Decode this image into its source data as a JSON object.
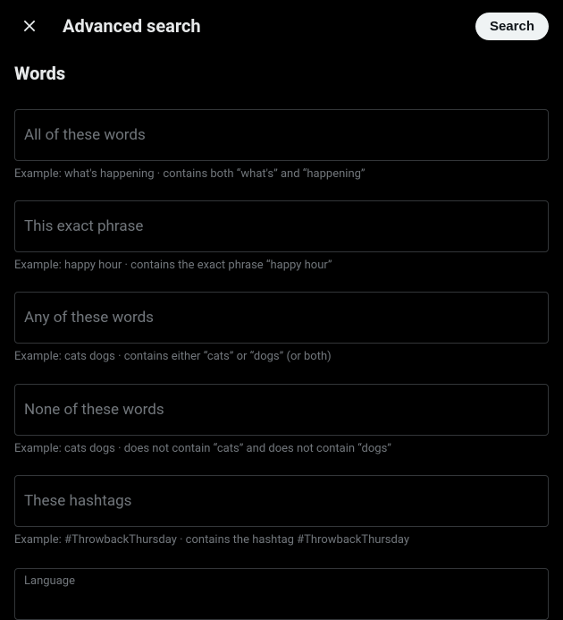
{
  "header": {
    "title": "Advanced search",
    "search_label": "Search"
  },
  "section": {
    "words_title": "Words"
  },
  "fields": {
    "all_words": {
      "label": "All of these words",
      "example": "Example: what's happening · contains both “what's” and “happening”"
    },
    "exact_phrase": {
      "label": "This exact phrase",
      "example": "Example: happy hour · contains the exact phrase “happy hour”"
    },
    "any_words": {
      "label": "Any of these words",
      "example": "Example: cats dogs · contains either “cats” or “dogs” (or both)"
    },
    "none_words": {
      "label": "None of these words",
      "example": "Example: cats dogs · does not contain “cats” and does not contain “dogs”"
    },
    "hashtags": {
      "label": "These hashtags",
      "example": "Example: #ThrowbackThursday · contains the hashtag #ThrowbackThursday"
    },
    "language": {
      "label": "Language"
    }
  }
}
